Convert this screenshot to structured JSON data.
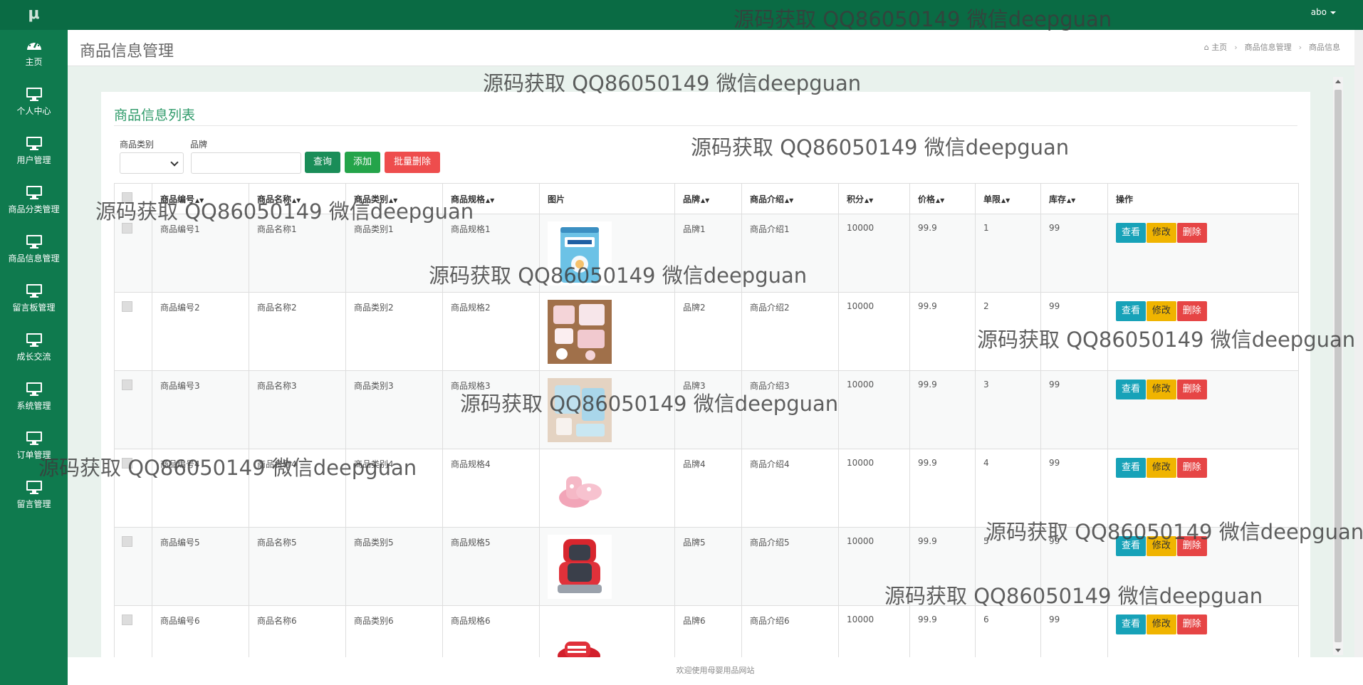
{
  "app": {
    "logo": "μ",
    "user_menu": "abo"
  },
  "sidebar": {
    "items": [
      {
        "label": "主页",
        "icon": "dashboard-icon"
      },
      {
        "label": "个人中心",
        "icon": "monitor-icon"
      },
      {
        "label": "用户管理",
        "icon": "monitor-icon"
      },
      {
        "label": "商品分类管理",
        "icon": "monitor-icon"
      },
      {
        "label": "商品信息管理",
        "icon": "monitor-icon"
      },
      {
        "label": "留言板管理",
        "icon": "monitor-icon"
      },
      {
        "label": "成长交流",
        "icon": "monitor-icon"
      },
      {
        "label": "系统管理",
        "icon": "monitor-icon"
      },
      {
        "label": "订单管理",
        "icon": "monitor-icon"
      },
      {
        "label": "留言管理",
        "icon": "monitor-icon"
      }
    ]
  },
  "header": {
    "title": "商品信息管理",
    "breadcrumb": [
      "主页",
      "商品信息管理",
      "商品信息"
    ]
  },
  "panel": {
    "title": "商品信息列表",
    "filters": {
      "category_label": "商品类别",
      "category_value": "",
      "brand_label": "品牌",
      "brand_value": ""
    },
    "buttons": {
      "query": "查询",
      "add": "添加",
      "batch_delete": "批量删除"
    }
  },
  "table": {
    "columns": [
      "商品编号",
      "商品名称",
      "商品类别",
      "商品规格",
      "图片",
      "品牌",
      "商品介绍",
      "积分",
      "价格",
      "单限",
      "库存",
      "操作"
    ],
    "actions": {
      "view": "查看",
      "edit": "修改",
      "delete": "删除"
    },
    "rows": [
      {
        "code": "商品编号1",
        "name": "商品名称1",
        "category": "商品类别1",
        "spec": "商品规格1",
        "image": "formula-can",
        "brand": "品牌1",
        "intro": "商品介绍1",
        "points": "10000",
        "price": "99.9",
        "limit": "1",
        "stock": "99"
      },
      {
        "code": "商品编号2",
        "name": "商品名称2",
        "category": "商品类别2",
        "spec": "商品规格2",
        "image": "baby-clothes-set",
        "brand": "品牌2",
        "intro": "商品介绍2",
        "points": "10000",
        "price": "99.9",
        "limit": "2",
        "stock": "99"
      },
      {
        "code": "商品编号3",
        "name": "商品名称3",
        "category": "商品类别3",
        "spec": "商品规格3",
        "image": "baby-outfit",
        "brand": "品牌3",
        "intro": "商品介绍3",
        "points": "10000",
        "price": "99.9",
        "limit": "3",
        "stock": "99"
      },
      {
        "code": "商品编号4",
        "name": "商品名称4",
        "category": "商品类别4",
        "spec": "商品规格4",
        "image": "pink-booties",
        "brand": "品牌4",
        "intro": "商品介绍4",
        "points": "10000",
        "price": "99.9",
        "limit": "4",
        "stock": "99"
      },
      {
        "code": "商品编号5",
        "name": "商品名称5",
        "category": "商品类别5",
        "spec": "商品规格5",
        "image": "car-seat",
        "brand": "品牌5",
        "intro": "商品介绍5",
        "points": "10000",
        "price": "99.9",
        "limit": "5",
        "stock": "99"
      },
      {
        "code": "商品编号6",
        "name": "商品名称6",
        "category": "商品类别6",
        "spec": "商品规格6",
        "image": "red-shoes",
        "brand": "品牌6",
        "intro": "商品介绍6",
        "points": "10000",
        "price": "99.9",
        "limit": "6",
        "stock": "99"
      }
    ]
  },
  "footer": {
    "text": "欢迎使用母婴用品网站"
  },
  "watermark": {
    "text": "源码获取 QQ86050149 微信deepguan"
  },
  "colors": {
    "primary": "#0a6b44",
    "sidebar": "#0f7a4e",
    "accent_title": "#2e9a69",
    "view": "#17a2b8",
    "edit": "#f0b400",
    "delete": "#e64545"
  }
}
